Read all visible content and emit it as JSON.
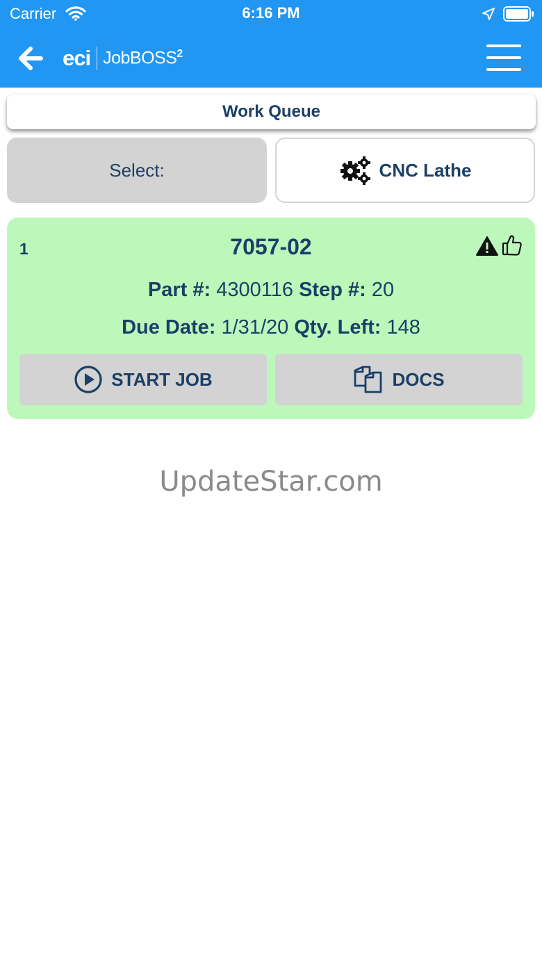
{
  "status_bar": {
    "carrier": "Carrier",
    "time": "6:16 PM",
    "icons": [
      "wifi-icon",
      "location-arrow-icon",
      "battery-icon"
    ]
  },
  "nav_bar": {
    "back_icon": "arrow-left-icon",
    "logo_brand": "eci",
    "logo_product": "JobBOSS",
    "logo_superscript": "2",
    "menu_icon": "hamburger-menu-icon"
  },
  "page_title": "Work Queue",
  "filters": {
    "select_label": "Select:",
    "machine_icon": "gears-icon",
    "machine_label": "CNC Lathe"
  },
  "job_card": {
    "index": "1",
    "job_number": "7057-02",
    "status_icons": [
      "warning-icon",
      "thumbs-up-icon"
    ],
    "part_label": "Part #:",
    "part_value": "4300116",
    "step_label": "Step #:",
    "step_value": "20",
    "due_label": "Due Date:",
    "due_value": "1/31/20",
    "qty_label": "Qty. Left:",
    "qty_value": "148",
    "start_button_label": "START JOB",
    "start_button_icon": "play-circle-icon",
    "docs_button_label": "DOCS",
    "docs_button_icon": "copy-documents-icon"
  },
  "watermark": "UpdateStar.com",
  "colors": {
    "header_blue": "#2196f3",
    "navy_text": "#1b3f66",
    "card_green": "#bdf8bb",
    "button_gray": "#d3d3d3",
    "watermark_gray": "#8a8a8a"
  }
}
